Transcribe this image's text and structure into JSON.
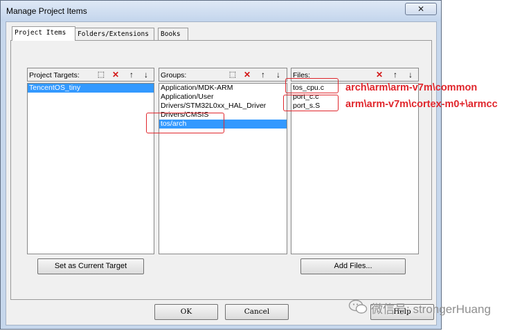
{
  "window": {
    "title": "Manage Project Items",
    "close_label": "✕"
  },
  "tabs": [
    {
      "label": "Project Items",
      "active": true
    },
    {
      "label": "Folders/Extensions",
      "active": false
    },
    {
      "label": "Books",
      "active": false
    }
  ],
  "targets": {
    "label": "Project Targets:",
    "items": [
      "TencentOS_tiny"
    ],
    "selected_index": 0,
    "set_current_label": "Set as Current Target"
  },
  "groups": {
    "label": "Groups:",
    "items": [
      "Application/MDK-ARM",
      "Application/User",
      "Drivers/STM32L0xx_HAL_Driver",
      "Drivers/CMSIS",
      "tos/arch"
    ],
    "selected_index": 4
  },
  "files": {
    "label": "Files:",
    "items": [
      "tos_cpu.c",
      "port_c.c",
      "port_s.S"
    ],
    "add_files_label": "Add Files..."
  },
  "footer": {
    "ok_label": "OK",
    "cancel_label": "Cancel",
    "help_label": "Help"
  },
  "annotations": [
    {
      "text": "arch\\arm\\arm-v7m\\common"
    },
    {
      "text": "arm\\arm-v7m\\cortex-m0+\\armcc"
    }
  ],
  "watermark": {
    "text": "微信号: strongerHuang"
  },
  "icons": {
    "new": "new-item-icon",
    "delete": "delete-icon",
    "up": "move-up-icon",
    "down": "move-down-icon"
  },
  "colors": {
    "selection": "#3399ff",
    "annotation": "#e0262c",
    "delete_icon": "#d21313"
  }
}
